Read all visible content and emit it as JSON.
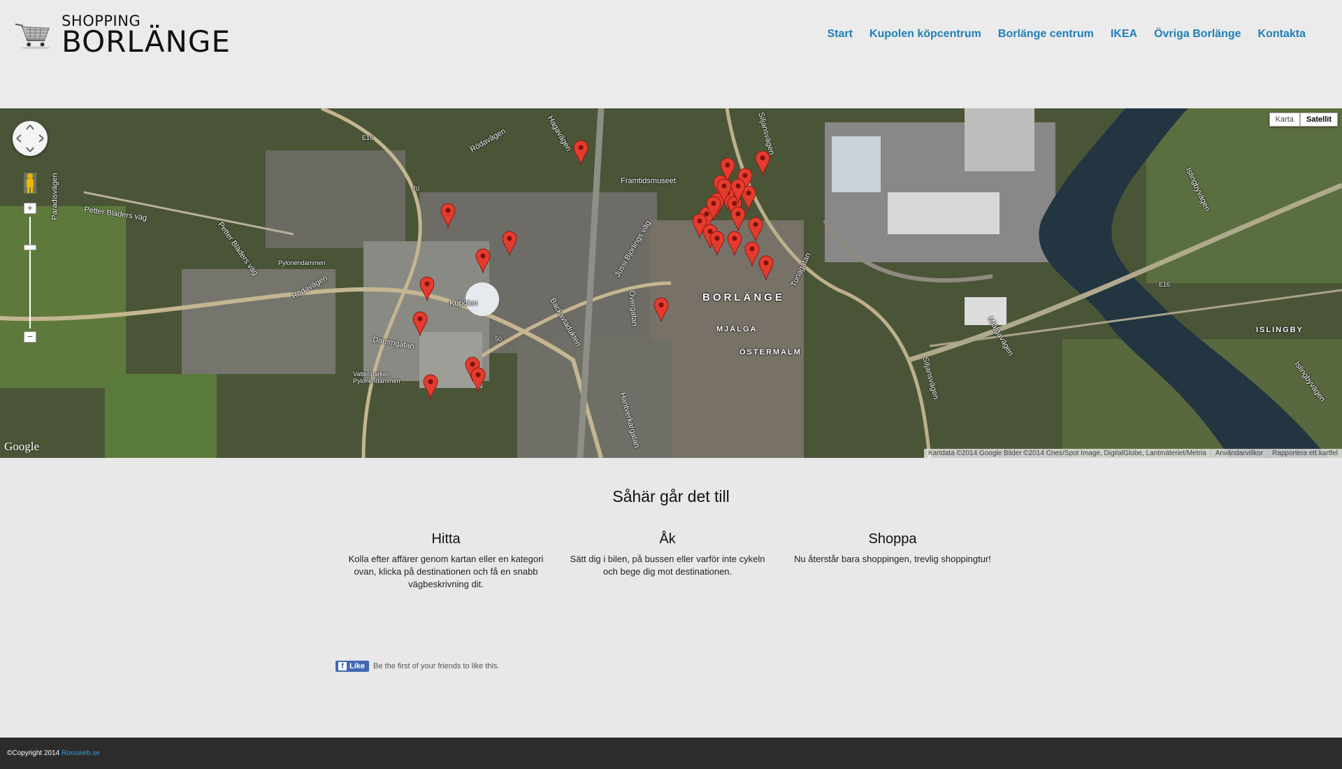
{
  "header": {
    "logo_top": "SHOPPING",
    "logo_bottom": "BORLÄNGE",
    "nav": [
      {
        "label": "Start"
      },
      {
        "label": "Kupolen köpcentrum"
      },
      {
        "label": "Borlänge centrum"
      },
      {
        "label": "IKEA"
      },
      {
        "label": "Övriga Borlänge"
      },
      {
        "label": "Kontakta"
      }
    ]
  },
  "map": {
    "type_buttons": {
      "map": "Karta",
      "satellite": "Satellit"
    },
    "google": "Google",
    "attribution": {
      "data": "Kartdata ©2014 Google Bilder ©2014 Cnes/Spot Image, DigitalGlobe, Lantmäteriet/Metria",
      "terms": "Användarvillkor",
      "report": "Rapportera ett kartfel"
    },
    "labels": {
      "borlange": "BORLÄNGE",
      "mjalga": "MJÄLGA",
      "ostermalm": "ÖSTERMALM",
      "islingby": "ISLINGBY",
      "kupolen": "Kupolen",
      "framtidsmuseet": "Framtidsmuseet",
      "pylonendammen": "Pylonendammen",
      "vattenparken": "Vattenparken Pylonendammen",
      "petter_bladers": "Petter Bläders väg",
      "rodavagen": "Rödavägen",
      "dammgatan": "Dammgatan",
      "paradisvagen": "Paradisvägen",
      "hagavagen": "Hagavägen",
      "jussi": "Jussi Björlings väg",
      "backaviadukten": "Backaviadukten",
      "hantverkargatan": "Hantverkargatan",
      "siljansvagen": "Siljansvägen",
      "tunagatan": "Tunagatan",
      "mjalgavagen": "Mjälgavägen",
      "islingbyvagen": "Islingbyvägen",
      "overgatan": "Övergatan",
      "e16": "E16",
      "r70": "70",
      "r50": "50"
    },
    "marker_color": "#e53b2e",
    "marker_count": 30
  },
  "howto": {
    "title": "Såhär går det till",
    "columns": [
      {
        "title": "Hitta",
        "text": "Kolla efter affärer genom kartan eller en kategori ovan, klicka på destinationen och få en snabb vägbeskrivning dit."
      },
      {
        "title": "Åk",
        "text": "Sätt dig i bilen, på bussen eller varför inte cykeln och bege dig mot destinationen."
      },
      {
        "title": "Shoppa",
        "text": "Nu återstår bara shoppingen, trevlig shoppingtur!"
      }
    ],
    "facebook": {
      "like": "Like",
      "text": "Be the first of your friends to like this."
    }
  },
  "footer": {
    "copyright": "©Copyright 2014",
    "link": "Roosweb.se"
  },
  "colors": {
    "nav_link": "#1e7fb8",
    "footer_bg": "#2c2c2c",
    "footer_link": "#2e9be0",
    "facebook": "#4267b2"
  }
}
